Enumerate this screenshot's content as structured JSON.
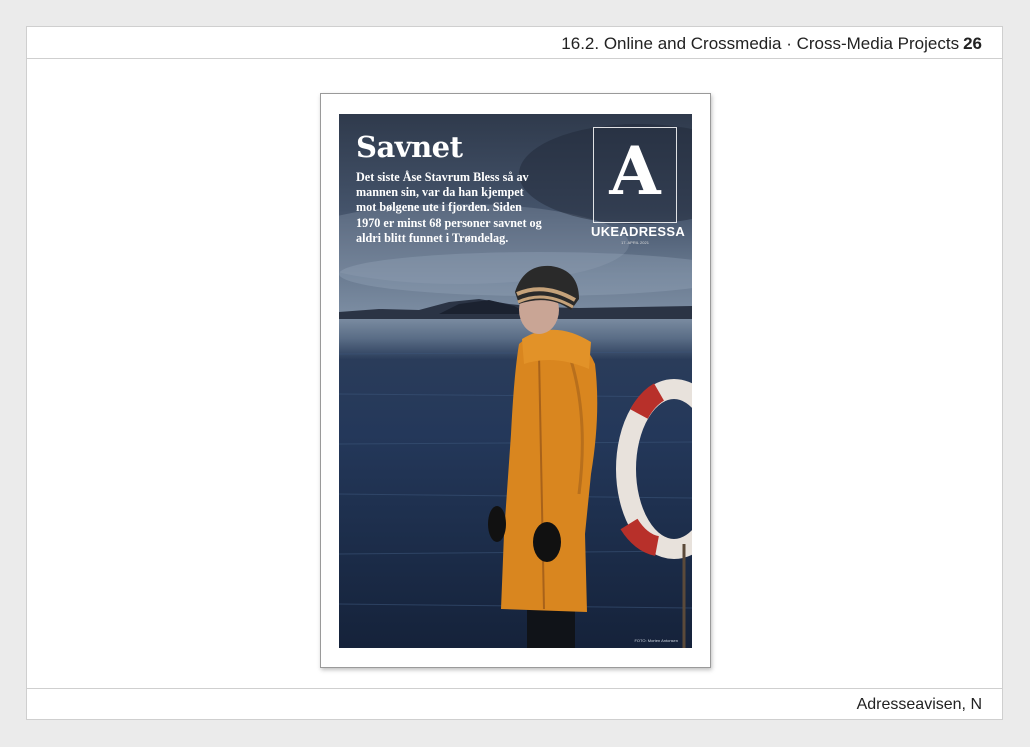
{
  "header": {
    "section": "16.2. Online and Crossmedia · Cross-Media Projects",
    "page_number": "26"
  },
  "cover": {
    "title": "Savnet",
    "lede": "Det siste Åse Stavrum Bless så av mannen sin, var da han kjempet mot bølgene ute i fjorden. Siden 1970 er minst 68 personer savnet og aldri blitt funnet i Trøndelag.",
    "logo_letter": "A",
    "logo_name": "UKEADRESSA",
    "logo_date": "17. APRIL 2021",
    "photo_credit": "FOTO: Morten Antonsen"
  },
  "footer": {
    "source": "Adresseavisen, N"
  }
}
